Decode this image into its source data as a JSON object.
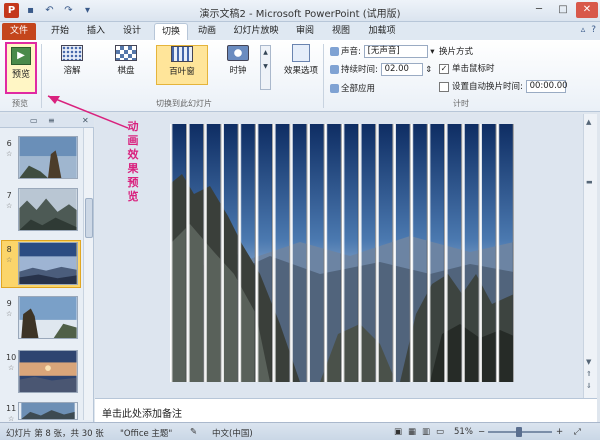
{
  "window": {
    "title": "演示文稿2 - Microsoft PowerPoint (试用版)",
    "qat_icons": [
      "powerpoint-logo-icon",
      "save-icon",
      "undo-icon",
      "redo-icon",
      "customize-qat-icon"
    ],
    "controls": {
      "minimize": "─",
      "maximize": "□",
      "close": "✕"
    }
  },
  "tabs": [
    {
      "label": "文件",
      "name": "tab-file"
    },
    {
      "label": "开始",
      "name": "tab-home"
    },
    {
      "label": "插入",
      "name": "tab-insert"
    },
    {
      "label": "设计",
      "name": "tab-design"
    },
    {
      "label": "切换",
      "name": "tab-transitions",
      "active": true
    },
    {
      "label": "动画",
      "name": "tab-animations"
    },
    {
      "label": "幻灯片放映",
      "name": "tab-slideshow"
    },
    {
      "label": "审阅",
      "name": "tab-review"
    },
    {
      "label": "视图",
      "name": "tab-view"
    },
    {
      "label": "加载项",
      "name": "tab-addins"
    }
  ],
  "ribbon": {
    "preview": {
      "label": "预览",
      "group": "预览"
    },
    "transitions": [
      {
        "label": "溶解",
        "icon": "dissolve"
      },
      {
        "label": "棋盘",
        "icon": "checkerboard"
      },
      {
        "label": "百叶窗",
        "icon": "blinds",
        "selected": true
      },
      {
        "label": "时钟",
        "icon": "clock"
      }
    ],
    "transitions_group": "切换到此幻灯片",
    "effect_options": "效果选项",
    "sound_label": "声音:",
    "sound_value": "[无声音]",
    "duration_label": "持续时间:",
    "duration_value": "02.00",
    "apply_all": "全部应用",
    "advance_title": "换片方式",
    "on_click": "单击鼠标时",
    "on_click_checked": true,
    "auto_after": "设置自动换片时间:",
    "auto_after_checked": false,
    "auto_time": "00:00.00",
    "timing_group": "计时"
  },
  "slides": [
    {
      "num": "6",
      "mark": "☆",
      "scene": "peak"
    },
    {
      "num": "7",
      "mark": "☆",
      "scene": "mist"
    },
    {
      "num": "8",
      "mark": "☆",
      "scene": "haze",
      "selected": true
    },
    {
      "num": "9",
      "mark": "☆",
      "scene": "rock"
    },
    {
      "num": "10",
      "mark": "☆",
      "scene": "sunrise"
    },
    {
      "num": "11",
      "mark": "☆",
      "scene": "sea"
    }
  ],
  "annotation": [
    "动",
    "画",
    "效",
    "果",
    "预",
    "览"
  ],
  "notes_placeholder": "单击此处添加备注",
  "status": {
    "slide_info": "幻灯片 第 8 张，共 30 张",
    "theme": "\"Office 主题\"",
    "language": "中文(中国)",
    "zoom": "51%"
  },
  "colors": {
    "annotation": "#d9227e",
    "file_tab": "#c4451c",
    "selection": "#fbd56a"
  },
  "blinds_panels": 20
}
